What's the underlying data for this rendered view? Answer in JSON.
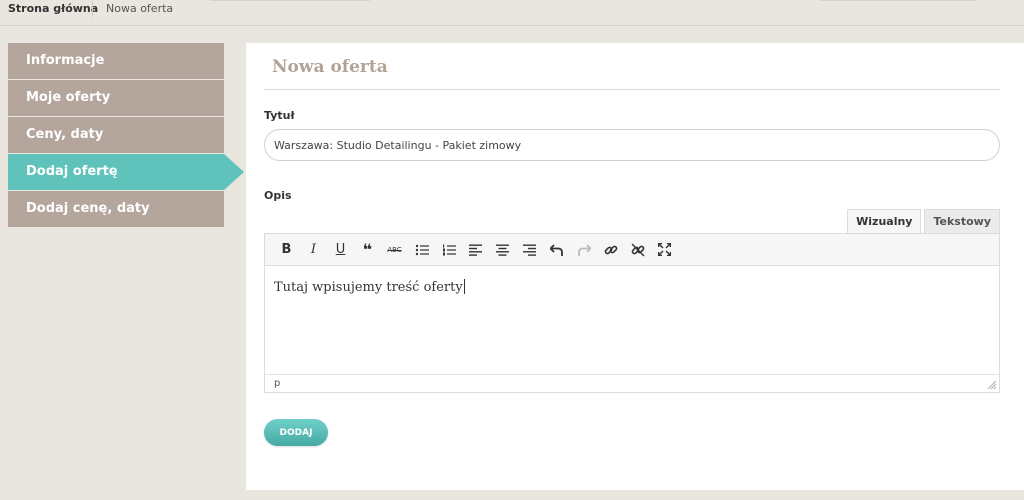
{
  "breadcrumb": {
    "home": "Strona główna",
    "current": "Nowa oferta"
  },
  "sidebar": {
    "items": [
      {
        "label": "Informacje"
      },
      {
        "label": "Moje oferty"
      },
      {
        "label": "Ceny, daty"
      },
      {
        "label": "Dodaj ofertę",
        "active": true
      },
      {
        "label": "Dodaj cenę, daty"
      }
    ]
  },
  "main": {
    "title": "Nowa oferta",
    "title_label": "Tytuł",
    "title_value": "Warszawa: Studio Detailingu - Pakiet zimowy",
    "desc_label": "Opis",
    "tabs": {
      "visual": "Wizualny",
      "text": "Tekstowy"
    },
    "toolbar": {
      "bold": "B",
      "italic": "I",
      "underline": "U",
      "quote": "❝",
      "strike": "ABC"
    },
    "content": "Tutaj wpisujemy treść oferty",
    "status_path": "p",
    "submit_label": "DODAJ"
  },
  "colors": {
    "background": "#e9e5df",
    "sidebar_item": "#b4a69c",
    "sidebar_active": "#5fc3bc",
    "title": "#b1a296",
    "button": "#4fb7b0"
  },
  "icons": {
    "toolbar": [
      "bold-icon",
      "italic-icon",
      "underline-icon",
      "blockquote-icon",
      "strikethrough-icon",
      "bullet-list-icon",
      "numbered-list-icon",
      "align-left-icon",
      "align-center-icon",
      "align-right-icon",
      "undo-icon",
      "redo-icon",
      "link-icon",
      "unlink-icon",
      "fullscreen-icon"
    ]
  }
}
